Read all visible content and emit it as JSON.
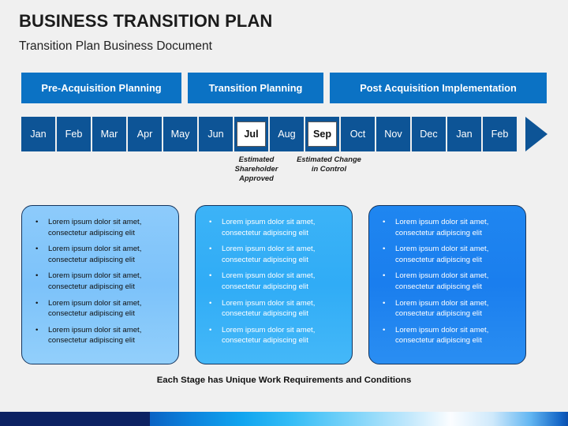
{
  "header": {
    "title": "BUSINESS TRANSITION PLAN",
    "subtitle": "Transition Plan Business Document"
  },
  "phases": [
    {
      "label": "Pre-Acquisition Planning"
    },
    {
      "label": "Transition Planning"
    },
    {
      "label": "Post Acquisition Implementation"
    }
  ],
  "timeline": {
    "months": [
      {
        "label": "Jan",
        "highlighted": false
      },
      {
        "label": "Feb",
        "highlighted": false
      },
      {
        "label": "Mar",
        "highlighted": false
      },
      {
        "label": "Apr",
        "highlighted": false
      },
      {
        "label": "May",
        "highlighted": false
      },
      {
        "label": "Jun",
        "highlighted": false
      },
      {
        "label": "Jul",
        "highlighted": true
      },
      {
        "label": "Aug",
        "highlighted": false
      },
      {
        "label": "Sep",
        "highlighted": true
      },
      {
        "label": "Oct",
        "highlighted": false
      },
      {
        "label": "Nov",
        "highlighted": false
      },
      {
        "label": "Dec",
        "highlighted": false
      },
      {
        "label": "Jan",
        "highlighted": false
      },
      {
        "label": "Feb",
        "highlighted": false
      }
    ]
  },
  "milestones": [
    {
      "label": "Estimated Shareholder Approved"
    },
    {
      "label": "Estimated Change in Control"
    }
  ],
  "panels": [
    {
      "bullets": [
        "Lorem ipsum dolor sit amet, consectetur adipiscing elit",
        "Lorem ipsum dolor sit amet, consectetur adipiscing elit",
        "Lorem ipsum dolor sit amet, consectetur adipiscing elit",
        "Lorem ipsum dolor sit amet, consectetur adipiscing elit",
        "Lorem ipsum dolor sit amet, consectetur adipiscing elit"
      ]
    },
    {
      "bullets": [
        "Lorem ipsum dolor sit amet, consectetur adipiscing elit",
        "Lorem ipsum dolor sit amet, consectetur adipiscing elit",
        "Lorem ipsum dolor sit amet, consectetur adipiscing elit",
        "Lorem ipsum dolor sit amet, consectetur adipiscing elit",
        "Lorem ipsum dolor sit amet, consectetur adipiscing elit"
      ]
    },
    {
      "bullets": [
        "Lorem ipsum dolor sit amet, consectetur adipiscing elit",
        "Lorem ipsum dolor sit amet, consectetur adipiscing elit",
        "Lorem ipsum dolor sit amet, consectetur adipiscing elit",
        "Lorem ipsum dolor sit amet, consectetur adipiscing elit",
        "Lorem ipsum dolor sit amet, consectetur adipiscing elit"
      ]
    }
  ],
  "footer": {
    "note": "Each Stage has Unique Work Requirements and Conditions"
  },
  "icons": {
    "bullet": "•",
    "timeline_arrow": "arrow-right-icon"
  },
  "colors": {
    "phase_box": "#0b72c4",
    "timeline_cell": "#0d5496",
    "panel_1": "#8dcbfb",
    "panel_2": "#30acf6",
    "panel_3": "#1a7eee",
    "panel_border": "#15355e",
    "band_navy": "#0d2263",
    "background": "#f0f0f0"
  }
}
